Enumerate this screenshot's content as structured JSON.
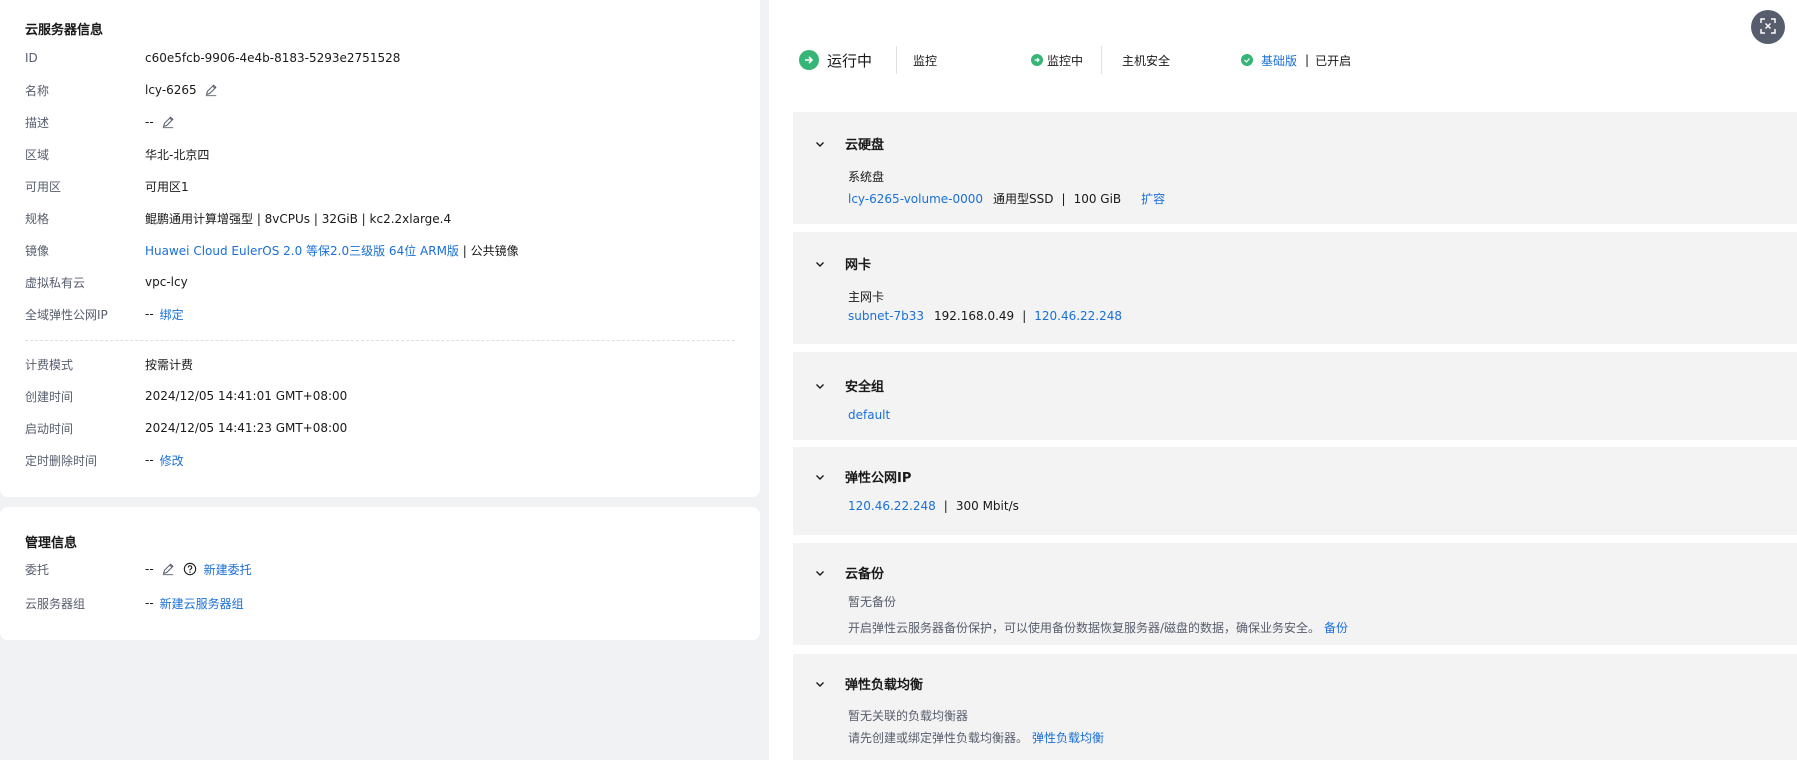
{
  "server_info": {
    "title": "云服务器信息",
    "rows": [
      {
        "label": "ID",
        "value": "c60e5fcb-9906-4e4b-8183-5293e2751528"
      },
      {
        "label": "名称",
        "value": "lcy-6265"
      },
      {
        "label": "描述",
        "value": "--"
      },
      {
        "label": "区域",
        "value": "华北-北京四"
      },
      {
        "label": "可用区",
        "value": "可用区1"
      },
      {
        "label": "规格",
        "value": "鲲鹏通用计算增强型 | 8vCPUs | 32GiB | kc2.2xlarge.4"
      },
      {
        "label": "镜像",
        "link": "Huawei Cloud EulerOS 2.0 等保2.0三级版 64位 ARM版",
        "suffix": " | 公共镜像"
      },
      {
        "label": "虚拟私有云",
        "link": "vpc-lcy"
      },
      {
        "label": "全域弹性公网IP",
        "value": "--",
        "link": "绑定"
      }
    ],
    "billing_rows": [
      {
        "label": "计费模式",
        "value": "按需计费"
      },
      {
        "label": "创建时间",
        "value": "2024/12/05 14:41:01 GMT+08:00"
      },
      {
        "label": "启动时间",
        "value": "2024/12/05 14:41:23 GMT+08:00"
      },
      {
        "label": "定时删除时间",
        "value": "--",
        "link": "修改"
      }
    ]
  },
  "management": {
    "title": "管理信息",
    "delegate_label": "委托",
    "delegate_value": "--",
    "delegate_link": "新建委托",
    "group_label": "云服务器组",
    "group_value": "--",
    "group_link": "新建云服务器组"
  },
  "status": {
    "running": "运行中",
    "monitor_label": "监控",
    "monitor_status": "监控中",
    "host_security_label": "主机安全",
    "host_security_edition": "基础版",
    "host_security_state": "已开启"
  },
  "sections": {
    "disk": {
      "title": "云硬盘",
      "sub": "系统盘",
      "volume": "lcy-6265-volume-0000",
      "type": "通用型SSD",
      "size": "100 GiB",
      "expand": "扩容"
    },
    "nic": {
      "title": "网卡",
      "sub": "主网卡",
      "subnet": "subnet-7b33",
      "private_ip": "192.168.0.49",
      "public_ip": "120.46.22.248"
    },
    "security_group": {
      "title": "安全组",
      "name": "default"
    },
    "eip": {
      "title": "弹性公网IP",
      "ip": "120.46.22.248",
      "bandwidth": "300 Mbit/s"
    },
    "backup": {
      "title": "云备份",
      "none": "暂无备份",
      "desc": "开启弹性云服务器备份保护，可以使用备份数据恢复服务器/磁盘的数据，确保业务安全。",
      "link": "备份"
    },
    "elb": {
      "title": "弹性负载均衡",
      "none": "暂无关联的负载均衡器",
      "desc": "请先创建或绑定弹性负载均衡器。",
      "link": "弹性负载均衡"
    }
  },
  "colors": {
    "link": "#1a6fd8",
    "success": "#37b577",
    "label": "#575d6c"
  },
  "icons": [
    "edit-icon",
    "help-icon",
    "chevron-down-icon",
    "running-icon",
    "check-circle-icon",
    "fullscreen-icon"
  ]
}
